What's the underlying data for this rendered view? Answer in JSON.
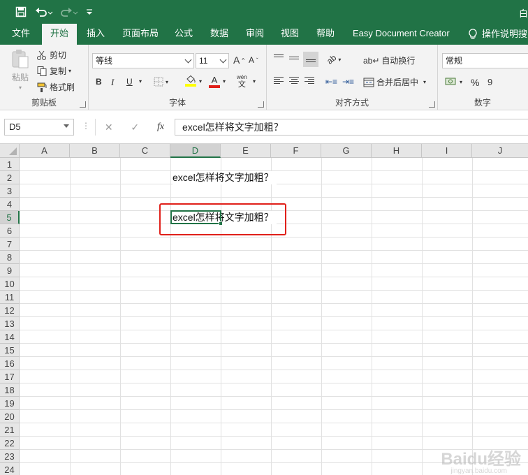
{
  "title_bar": {
    "right_text": "白",
    "qat": [
      "save-icon",
      "undo-icon",
      "redo-icon",
      "customize-qat-icon"
    ]
  },
  "tabs": [
    {
      "label": "文件"
    },
    {
      "label": "开始",
      "active": true
    },
    {
      "label": "插入"
    },
    {
      "label": "页面布局"
    },
    {
      "label": "公式"
    },
    {
      "label": "数据"
    },
    {
      "label": "审阅"
    },
    {
      "label": "视图"
    },
    {
      "label": "帮助"
    },
    {
      "label": "Easy Document Creator"
    },
    {
      "label": "操作说明搜"
    }
  ],
  "ribbon": {
    "clipboard": {
      "paste": "粘贴",
      "cut": "剪切",
      "copy": "复制",
      "format_painter": "格式刷",
      "label": "剪贴板"
    },
    "font": {
      "font_name": "等线",
      "font_size": "11",
      "bold": "B",
      "italic": "I",
      "underline": "U",
      "phonetic": "wén",
      "phonetic_char": "文",
      "grow": "A",
      "shrink": "A",
      "font_color_letter": "A",
      "label": "字体"
    },
    "alignment": {
      "wrap_text": "自动换行",
      "merge_center": "合并后居中",
      "label": "对齐方式"
    },
    "number": {
      "format": "常规",
      "percent": "%",
      "comma": "9",
      "label": "数字"
    }
  },
  "formula_bar": {
    "name_box": "D5",
    "cancel": "✕",
    "enter": "✓",
    "fx": "fx",
    "content": "excel怎样将文字加粗？"
  },
  "grid": {
    "columns": [
      "A",
      "B",
      "C",
      "D",
      "E",
      "F",
      "G",
      "H",
      "I",
      "J"
    ],
    "rows": [
      "1",
      "2",
      "3",
      "4",
      "5",
      "6",
      "7",
      "8",
      "9",
      "10",
      "11",
      "12",
      "13",
      "14",
      "15",
      "16",
      "17",
      "18",
      "19",
      "20",
      "21",
      "22",
      "23",
      "24"
    ],
    "selected_column": "D",
    "selected_row": "5",
    "cells": [
      {
        "ref": "D2",
        "text": "excel怎样将文字加粗？"
      },
      {
        "ref": "D5",
        "text": "excel怎样将文字加粗？"
      }
    ]
  },
  "watermark": {
    "text": "Baidu经验",
    "sub": "jingyan.baidu.com"
  },
  "colors": {
    "excel_green": "#217346",
    "annotation_red": "#e0201a"
  }
}
